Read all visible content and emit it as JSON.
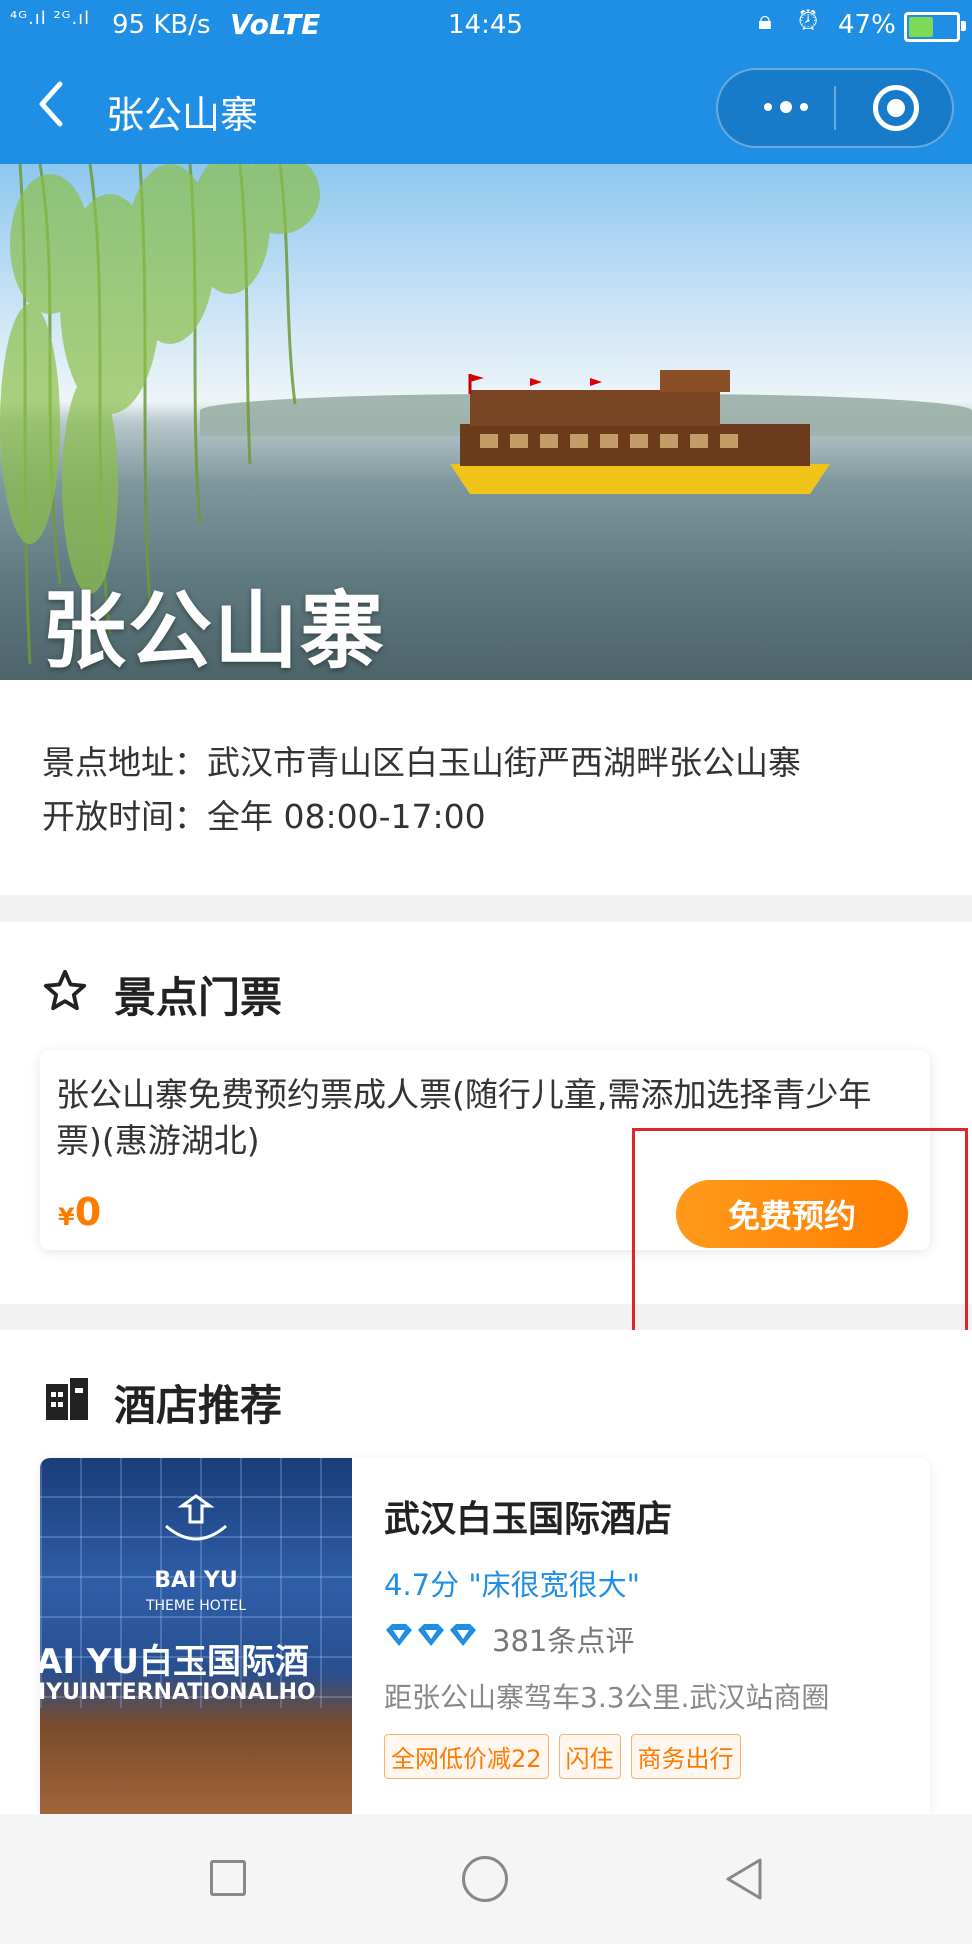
{
  "status_bar": {
    "signal": "⁴ᴳ.ıl ²ᴳ.ıl",
    "speed": "95 KB/s",
    "volte": "VoLTE",
    "time": "14:45",
    "battery": "47%"
  },
  "nav": {
    "title": "张公山寨",
    "back_icon": "chevron-left-icon",
    "more_icon": "more-dots-icon",
    "close_icon": "target-close-icon"
  },
  "hero": {
    "title": "张公山寨"
  },
  "info": {
    "address": "景点地址：武汉市青山区白玉山街严西湖畔张公山寨",
    "hours": "开放时间：全年 08:00-17:00"
  },
  "tickets": {
    "section_title": "景点门票",
    "section_icon": "star-outline-icon",
    "item": {
      "name": "张公山寨免费预约票成人票(随行儿童,需添加选择青少年票)(惠游湖北)",
      "currency": "¥",
      "price": "0",
      "button": "免费预约"
    }
  },
  "hotels": {
    "section_title": "酒店推荐",
    "section_icon": "building-icon",
    "items": [
      {
        "image_brand": "BAI YU",
        "image_sub": "THEME HOTEL",
        "image_sign": "AI YU白玉国际酒",
        "image_sign2": "IYUINTERNATIONALHO",
        "name": "武汉白玉国际酒店",
        "score": "4.7分 \"床很宽很大\"",
        "diamonds": 3,
        "reviews": "381条点评",
        "distance": "距张公山寨驾车3.3公里.武汉站商圈",
        "tags": [
          "全网低价减22",
          "闪住",
          "商务出行"
        ]
      }
    ]
  },
  "colors": {
    "primary": "#1f8ee5",
    "accent": "#ff7e00",
    "highlight_box": "#e0262a"
  }
}
